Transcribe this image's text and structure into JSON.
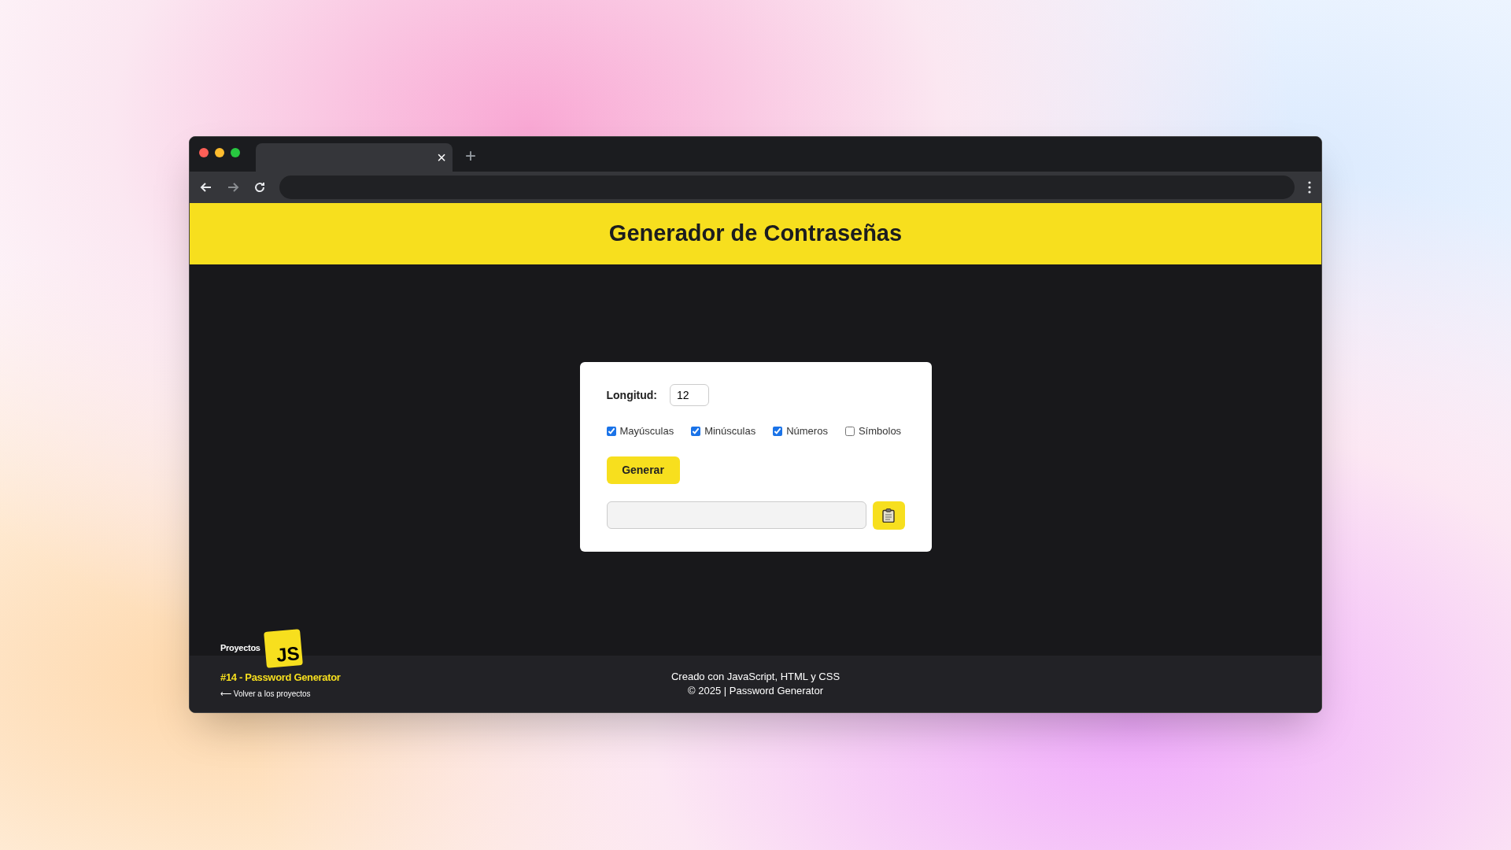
{
  "browser": {
    "tab_close": "×",
    "new_tab": "+"
  },
  "header": {
    "title": "Generador de Contraseñas"
  },
  "form": {
    "length_label": "Longitud:",
    "length_value": "12",
    "options": [
      {
        "label": "Mayúsculas",
        "checked": true
      },
      {
        "label": "Minúsculas",
        "checked": true
      },
      {
        "label": "Números",
        "checked": true
      },
      {
        "label": "Símbolos",
        "checked": false
      }
    ],
    "generate_button": "Generar"
  },
  "footer": {
    "lines": [
      "Creado con JavaScript, HTML y CSS",
      "© 2025 | Password Generator"
    ]
  },
  "projects_widget": {
    "label": "Proyectos",
    "logo": "JS",
    "project_title": "#14 - Password Generator",
    "back_link": "⟵ Volver a los proyectos"
  }
}
